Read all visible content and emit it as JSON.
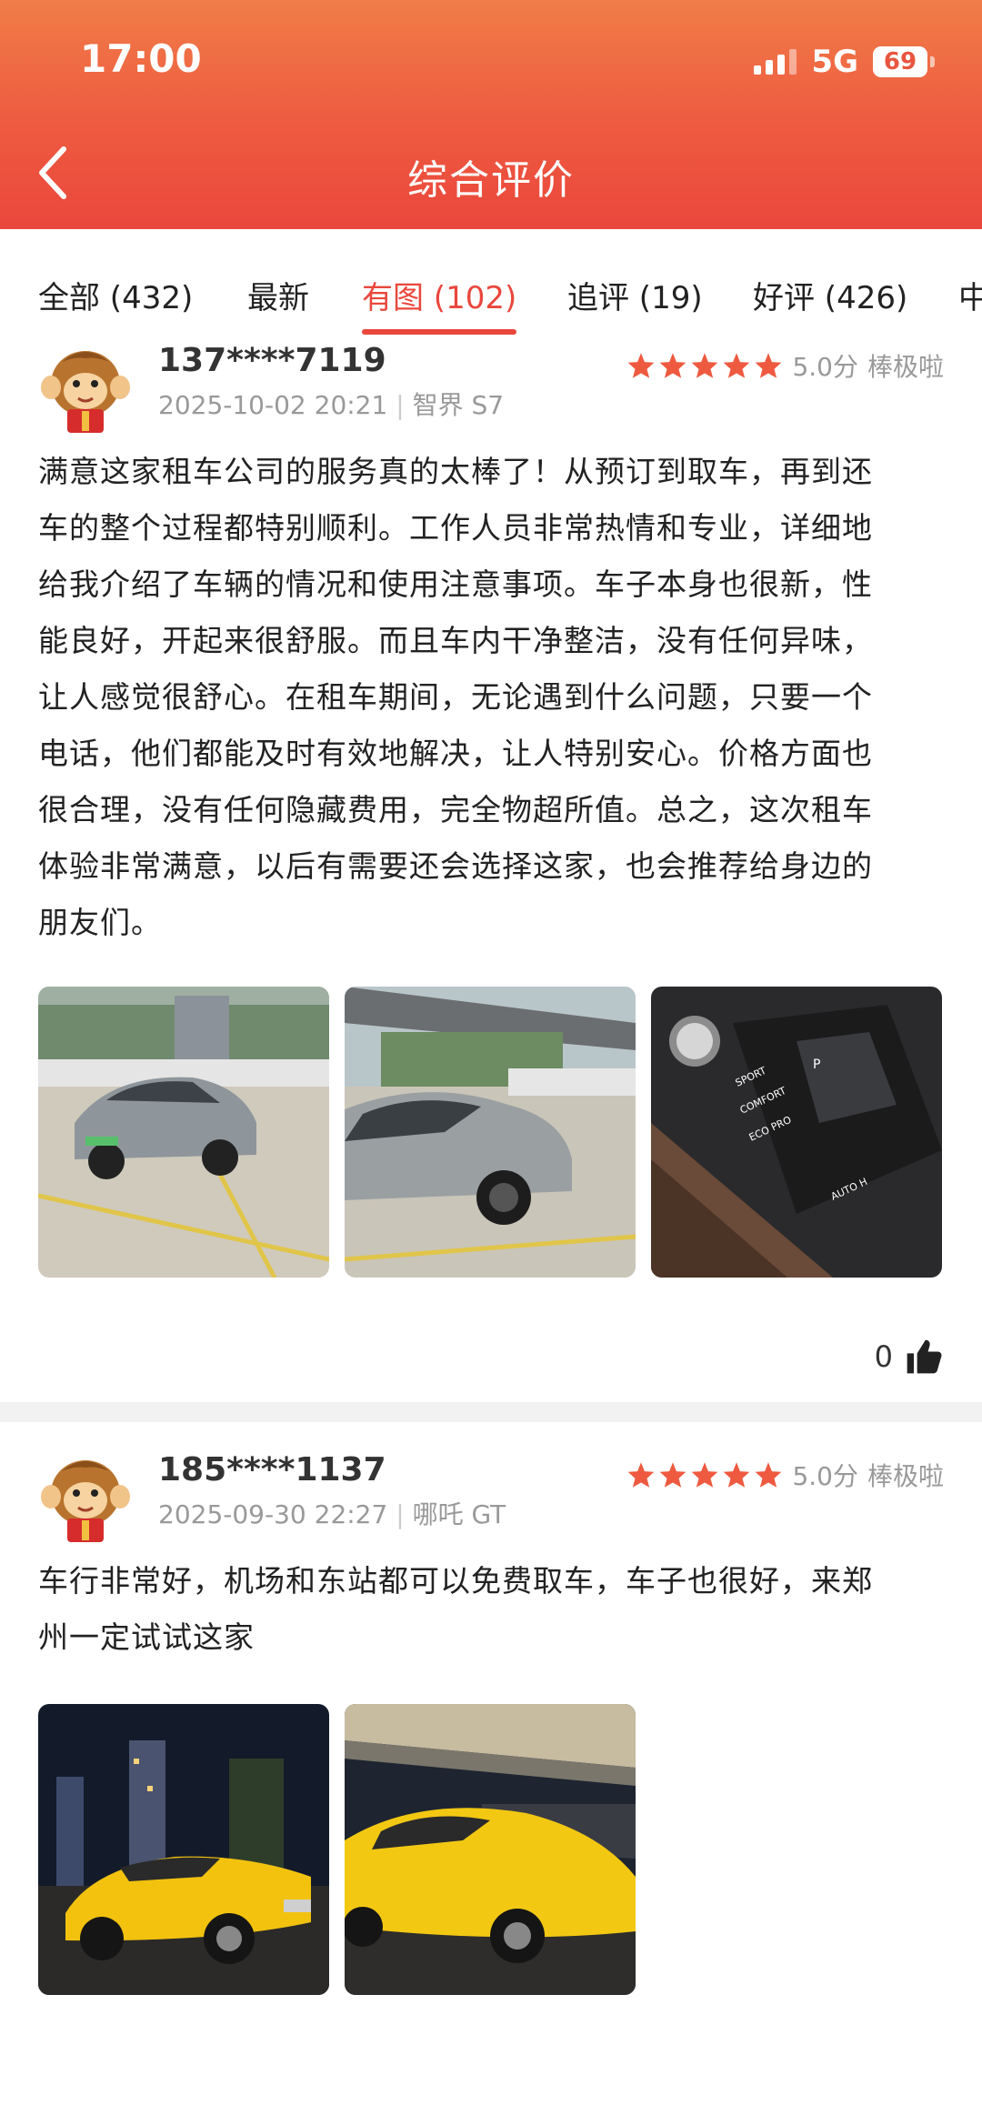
{
  "status_bar": {
    "time": "17:00",
    "network": "5G",
    "battery": "69"
  },
  "header": {
    "title": "综合评价"
  },
  "tabs": [
    {
      "label": "全部 (432)"
    },
    {
      "label": "最新"
    },
    {
      "label": "有图 (102)",
      "active": true
    },
    {
      "label": "追评 (19)"
    },
    {
      "label": "好评 (426)"
    },
    {
      "label": "中"
    }
  ],
  "reviews": [
    {
      "username": "137****7119",
      "date": "2025-10-02 20:21",
      "car": "智界 S7",
      "score": "5.0分",
      "score_text": "棒极啦",
      "text_lines": [
        "满意这家租车公司的服务真的太棒了！从预订到取车，再到还",
        "车的整个过程都特别顺利。工作人员非常热情和专业，详细地",
        "给我介绍了车辆的情况和使用注意事项。车子本身也很新，性",
        "能良好，开起来很舒服。而且车内干净整洁，没有任何异味，",
        "让人感觉很舒心。在租车期间，无论遇到什么问题，只要一个",
        "电话，他们都能及时有效地解决，让人特别安心。价格方面也",
        "很合理，没有任何隐藏费用，完全物超所值。总之，这次租车",
        "体验非常满意，以后有需要还会选择这家，也会推荐给身边的",
        "朋友们。"
      ],
      "likes": "0",
      "photos": [
        {
          "gear_labels": []
        },
        {
          "gear_labels": []
        },
        {
          "gear_labels": [
            "SPORT",
            "COMFORT",
            "ECO PRO",
            "AUTO H",
            "P"
          ]
        }
      ]
    },
    {
      "username": "185****1137",
      "date": "2025-09-30 22:27",
      "car": "哪吒 GT",
      "score": "5.0分",
      "score_text": "棒极啦",
      "text_lines": [
        "车行非常好，机场和东站都可以免费取车，车子也很好，来郑",
        "州一定试试这家"
      ]
    }
  ],
  "colors": {
    "accent": "#e9473c",
    "header_top": "#f07d48",
    "star": "#ee5a40"
  }
}
